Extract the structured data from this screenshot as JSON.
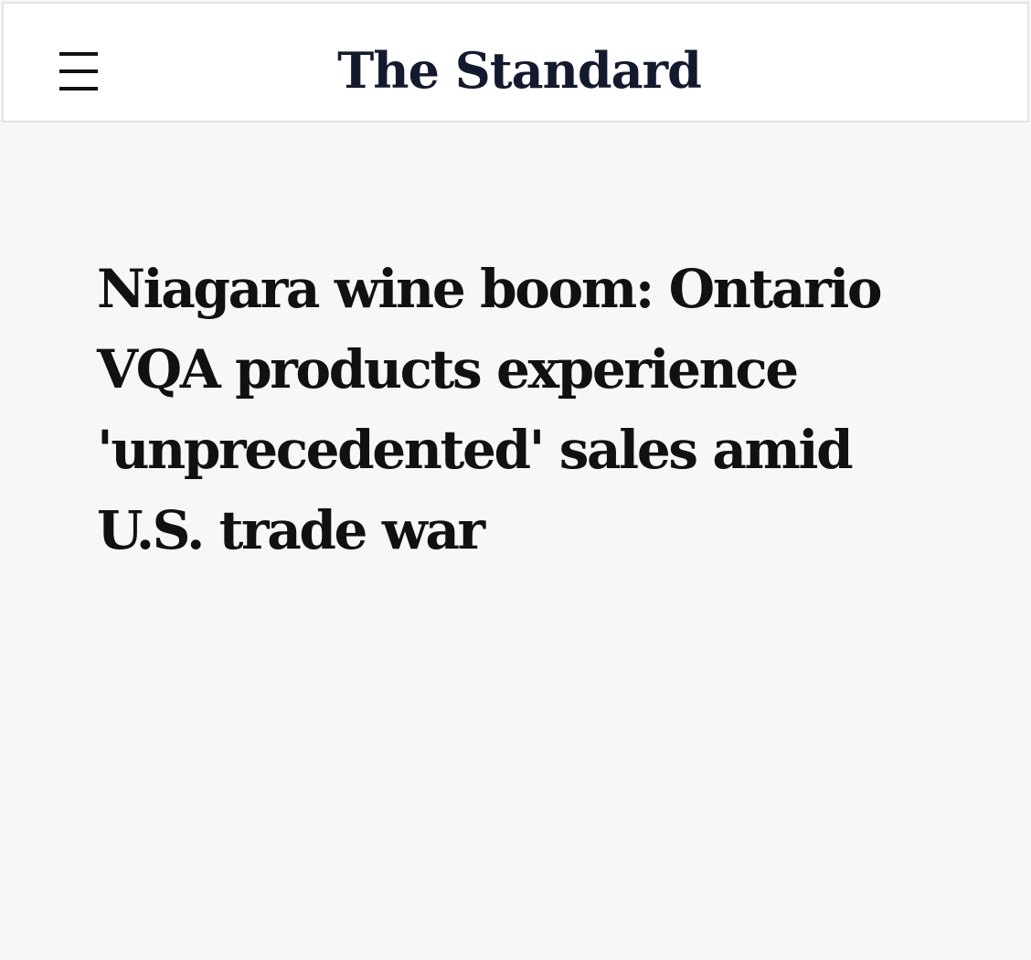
{
  "header": {
    "logo_text": "The Standard",
    "menu_icon": "hamburger-menu-icon"
  },
  "article": {
    "headline": "Niagara wine boom: Ontario VQA products experience 'unprecedented' sales amid U.S. trade war"
  },
  "colors": {
    "page_background": "#f7f7f7",
    "header_background": "#ffffff",
    "header_border": "#e4e4e4",
    "logo": "#141a2e",
    "headline": "#111111"
  }
}
